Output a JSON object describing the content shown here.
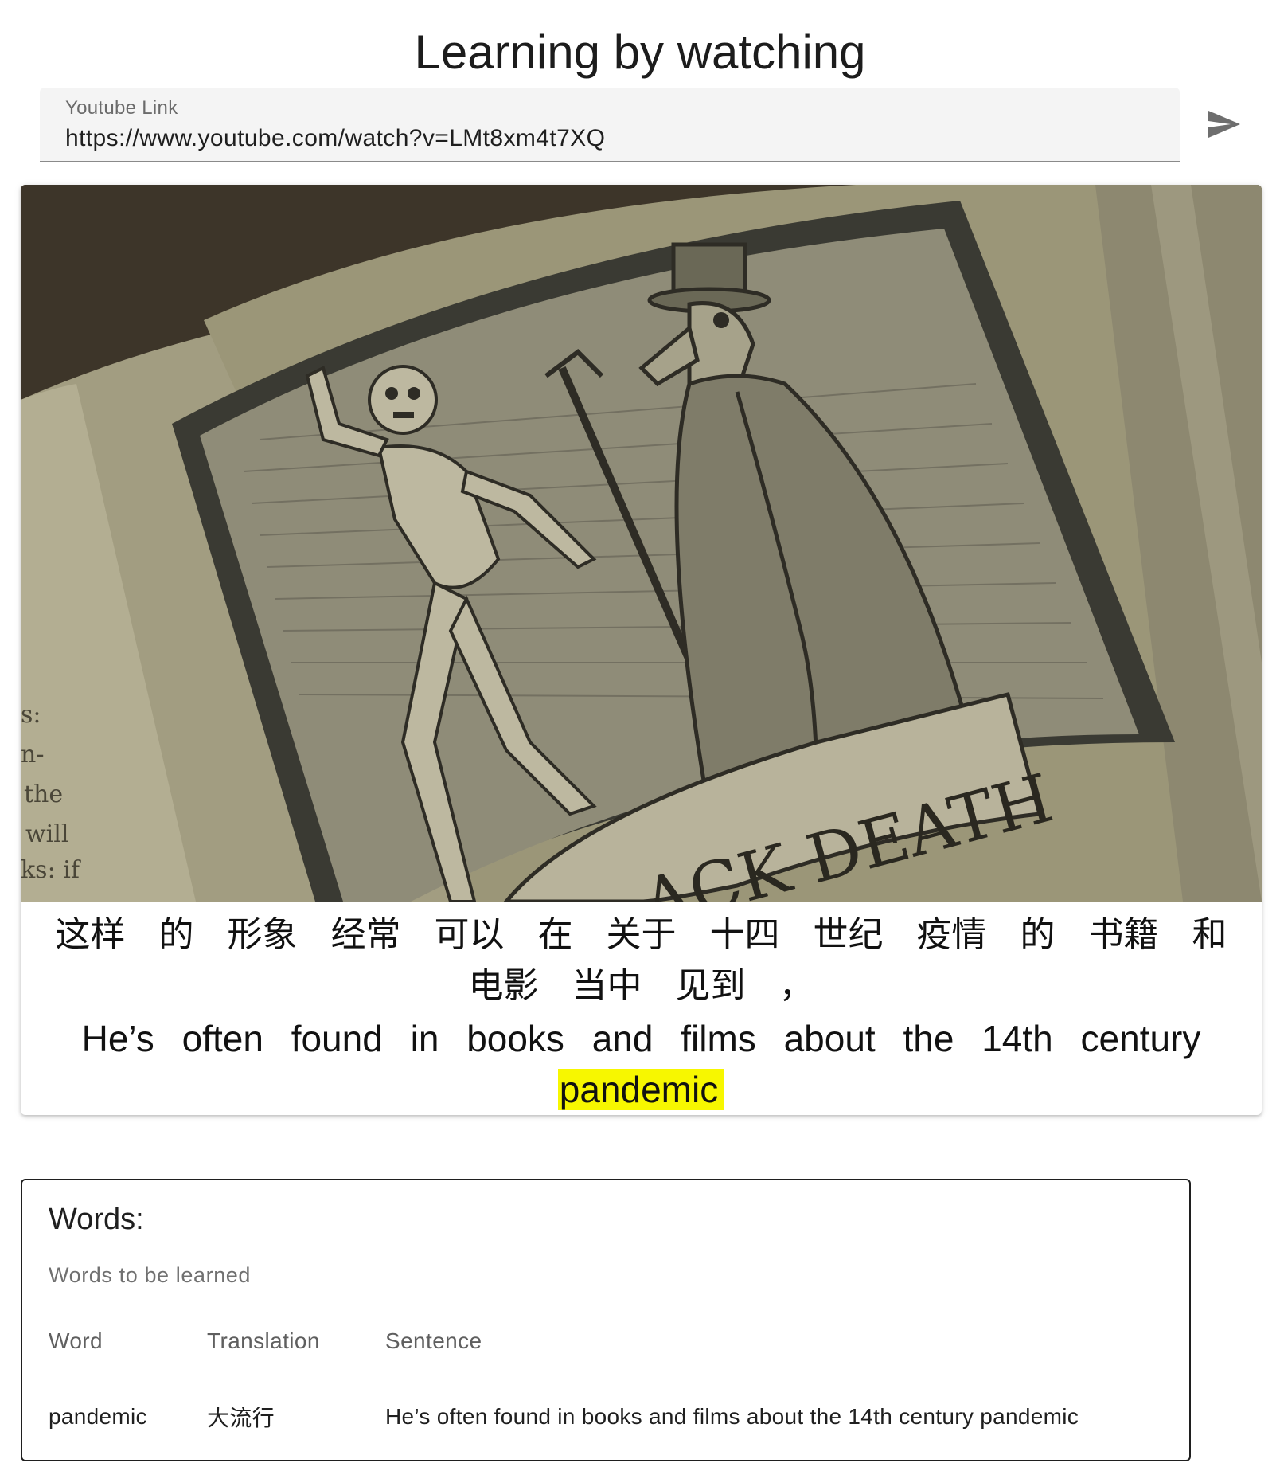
{
  "page": {
    "title": "Learning by watching"
  },
  "url_field": {
    "label": "Youtube Link",
    "value": "https://www.youtube.com/watch?v=LMt8xm4t7XQ",
    "submit_icon": "send-icon"
  },
  "video": {
    "banner_text": "ACK DEATH",
    "margin_text": [
      "s:",
      "n-",
      "the",
      "will",
      "ks: if"
    ]
  },
  "subtitles": {
    "chinese_words": [
      "这样",
      "的",
      "形象",
      "经常",
      "可以",
      "在",
      "关于",
      "十四",
      "世纪",
      "疫情",
      "的",
      "书籍",
      "和",
      "电影",
      "当中",
      "见到",
      "，"
    ],
    "english_words": [
      "He’s",
      "often",
      "found",
      "in",
      "books",
      "and",
      "films",
      "about",
      "the",
      "14th",
      "century",
      "pandemic"
    ],
    "highlighted_word": "pandemic",
    "highlight_color": "#f7f700"
  },
  "words_panel": {
    "title": "Words:",
    "subtitle": "Words to be learned",
    "columns": [
      "Word",
      "Translation",
      "Sentence"
    ],
    "rows": [
      {
        "word": "pandemic",
        "translation": "大流行",
        "sentence": "He’s often found in books and films about the 14th century pandemic"
      }
    ]
  }
}
